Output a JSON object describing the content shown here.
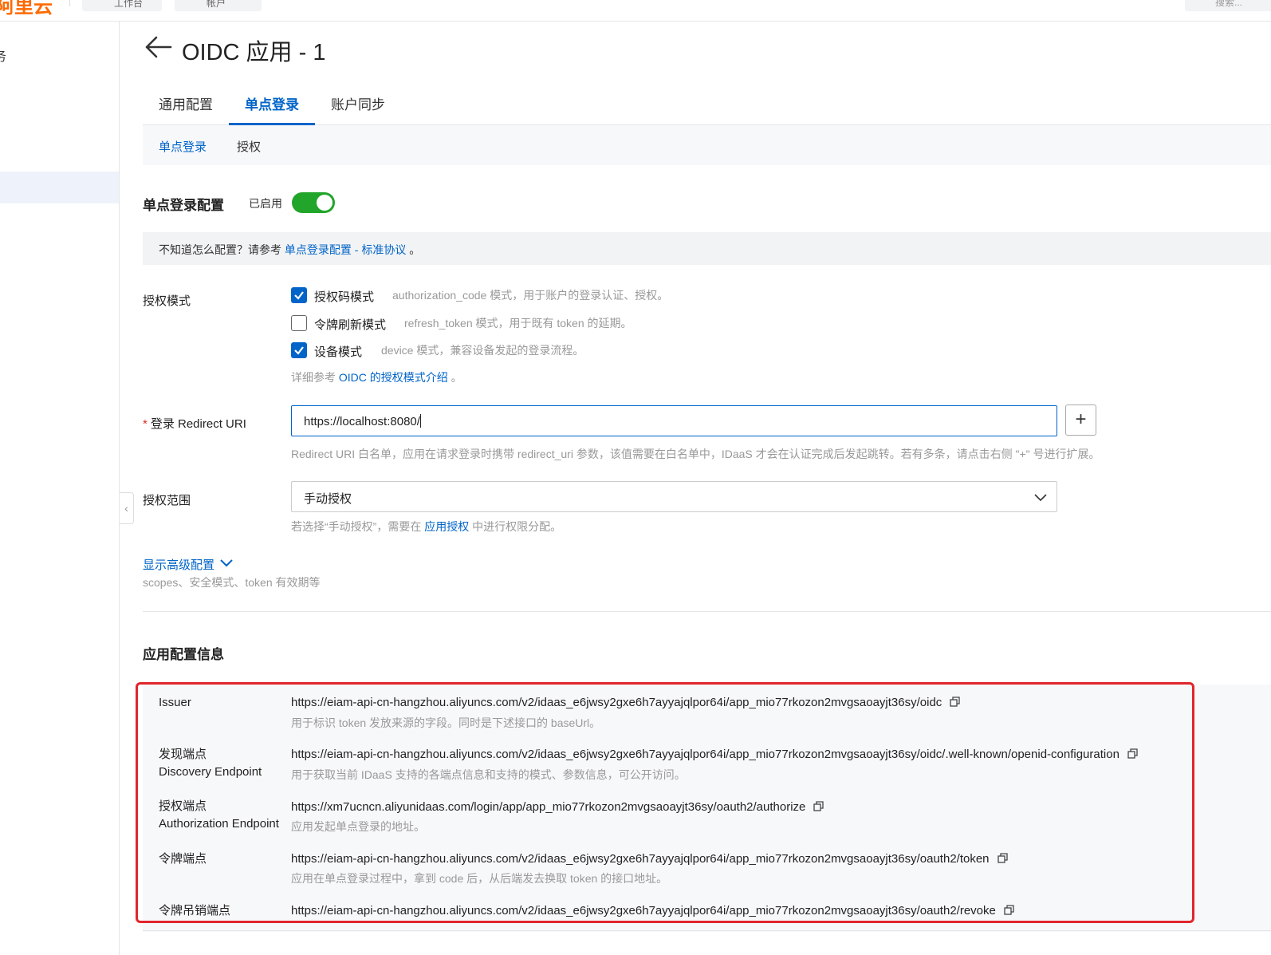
{
  "topbar": {
    "logo": "阿里云",
    "workbench": "工作台",
    "resource": "帐户",
    "search": "搜索..."
  },
  "sidebar": {
    "partial_text": "务"
  },
  "header": {
    "title": "OIDC 应用 - 1"
  },
  "tabs": [
    {
      "label": "通用配置"
    },
    {
      "label": "单点登录"
    },
    {
      "label": "账户同步"
    }
  ],
  "subtabs": [
    {
      "label": "单点登录"
    },
    {
      "label": "授权"
    }
  ],
  "sso": {
    "title": "单点登录配置",
    "status": "已启用",
    "enabled": true
  },
  "notice": {
    "text": "不知道怎么配置？请参考",
    "link": "单点登录配置 - 标准协议",
    "suffix": "。"
  },
  "grant": {
    "label": "授权模式",
    "options": [
      {
        "label": "授权码模式",
        "desc": "authorization_code 模式，用于账户的登录认证、授权。",
        "checked": true
      },
      {
        "label": "令牌刷新模式",
        "desc": "refresh_token 模式，用于既有 token 的延期。",
        "checked": false
      },
      {
        "label": "设备模式",
        "desc": "device 模式，兼容设备发起的登录流程。",
        "checked": true
      }
    ],
    "ref_text": "详细参考",
    "ref_link": "OIDC 的授权模式介绍",
    "ref_suffix": "。"
  },
  "redirect": {
    "required_mark": "*",
    "label": "登录 Redirect URI",
    "value": "https://localhost:8080/",
    "add_label": "+",
    "hint": "Redirect URI 白名单，应用在请求登录时携带 redirect_uri 参数，该值需要在白名单中，IDaaS 才会在认证完成后发起跳转。若有多条，请点击右侧 \"+\" 号进行扩展。"
  },
  "scope": {
    "label": "授权范围",
    "value": "手动授权",
    "hint_prefix": "若选择“手动授权”，需要在",
    "hint_link": "应用授权",
    "hint_suffix": "中进行权限分配。"
  },
  "advanced": {
    "toggle": "显示高级配置",
    "hint": "scopes、安全模式、token 有效期等"
  },
  "app_info": {
    "title": "应用配置信息",
    "rows": [
      {
        "label": "Issuer",
        "label2": "",
        "value": "https://eiam-api-cn-hangzhou.aliyuncs.com/v2/idaas_e6jwsy2gxe6h7ayyajqlpor64i/app_mio77rkozon2mvgsaoayjt36sy/oidc",
        "desc": "用于标识 token 发放来源的字段。同时是下述接口的 baseUrl。"
      },
      {
        "label": "发现端点",
        "label2": "Discovery Endpoint",
        "value": "https://eiam-api-cn-hangzhou.aliyuncs.com/v2/idaas_e6jwsy2gxe6h7ayyajqlpor64i/app_mio77rkozon2mvgsaoayjt36sy/oidc/.well-known/openid-configuration",
        "desc": "用于获取当前 IDaaS 支持的各端点信息和支持的模式、参数信息，可公开访问。"
      },
      {
        "label": "授权端点",
        "label2": "Authorization Endpoint",
        "value": "https://xm7ucncn.aliyunidaas.com/login/app/app_mio77rkozon2mvgsaoayjt36sy/oauth2/authorize",
        "desc": "应用发起单点登录的地址。"
      },
      {
        "label": "令牌端点",
        "label2": "",
        "value": "https://eiam-api-cn-hangzhou.aliyuncs.com/v2/idaas_e6jwsy2gxe6h7ayyajqlpor64i/app_mio77rkozon2mvgsaoayjt36sy/oauth2/token",
        "desc": "应用在单点登录过程中，拿到 code 后，从后端发去换取 token 的接口地址。"
      },
      {
        "label": "令牌吊销端点",
        "label2": "",
        "value": "https://eiam-api-cn-hangzhou.aliyuncs.com/v2/idaas_e6jwsy2gxe6h7ayyajqlpor64i/app_mio77rkozon2mvgsaoayjt36sy/oauth2/revoke",
        "desc": ""
      }
    ]
  },
  "colors": {
    "primary": "#0064c8",
    "toggle_on": "#21a52a",
    "highlight_frame": "#e0262c",
    "brand": "#ff6a00"
  }
}
